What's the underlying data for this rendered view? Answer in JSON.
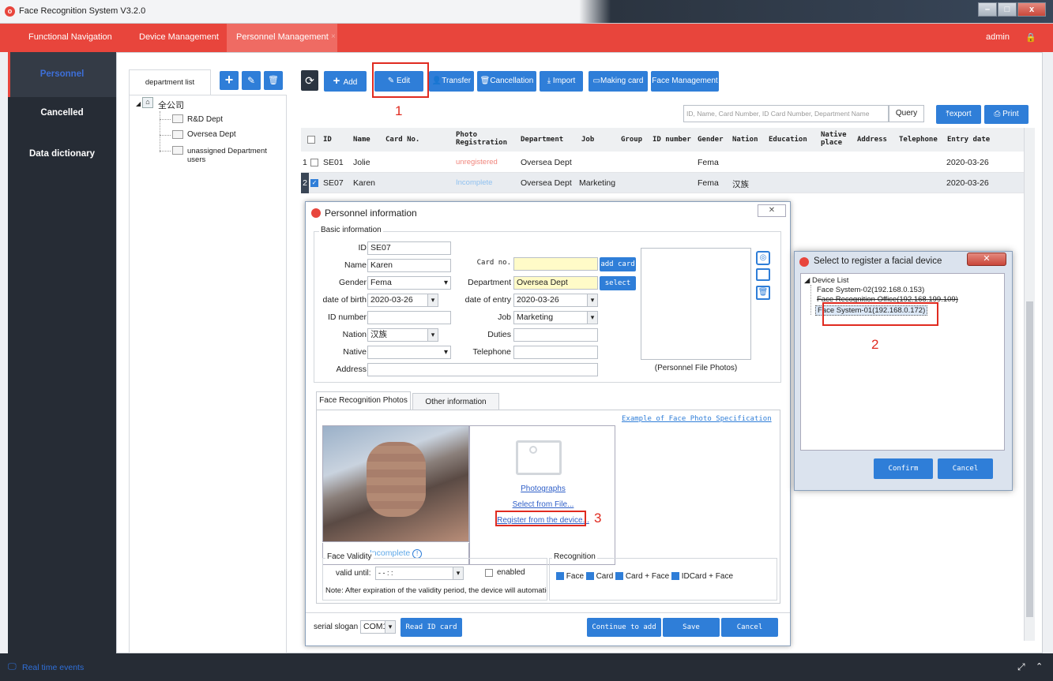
{
  "app": {
    "title": "Face Recognition System V3.2.0"
  },
  "topnav": {
    "items": [
      "Functional Navigation",
      "Device Management",
      "Personnel Management"
    ],
    "user": "admin"
  },
  "sidebar": {
    "items": [
      "Personnel",
      "Cancelled",
      "Data dictionary"
    ]
  },
  "dept": {
    "tab": "department list",
    "root": "全公司",
    "children": [
      "R&D Dept",
      "Oversea Dept",
      "unassigned Department users"
    ]
  },
  "toolbar": {
    "add": "Add",
    "edit": "Edit",
    "transfer": "Transfer",
    "cancellation": "Cancellation",
    "import": "Import",
    "making_card": "Making card",
    "face_mgmt": "Face Management"
  },
  "search": {
    "placeholder": "ID, Name, Card Number, ID Card Number, Department Name",
    "query": "Query",
    "export": "export",
    "print": "Print"
  },
  "table": {
    "columns": [
      "ID",
      "Name",
      "Card No.",
      "Photo Registration",
      "Department",
      "Job",
      "Group",
      "ID number",
      "Gender",
      "Nation",
      "Education",
      "Native place",
      "Address",
      "Telephone",
      "Entry date"
    ],
    "rows": [
      {
        "n": "1",
        "id": "SE01",
        "name": "Jolie",
        "photo": "unregistered",
        "dept": "Oversea Dept",
        "job": "",
        "gender": "Fema",
        "nation": "",
        "date": "2020-03-26"
      },
      {
        "n": "2",
        "id": "SE07",
        "name": "Karen",
        "photo": "Incomplete",
        "dept": "Oversea Dept",
        "job": "Marketing",
        "gender": "Fema",
        "nation": "汉族",
        "date": "2020-03-26"
      }
    ]
  },
  "markers": {
    "one": "1",
    "two": "2",
    "three": "3"
  },
  "dialog": {
    "title": "Personnel information",
    "basic": "Basic information",
    "labels": {
      "id": "ID",
      "name": "Name",
      "gender": "Gender",
      "dob": "date of birth",
      "idnum": "ID number",
      "nation": "Nation",
      "native": "Native",
      "address": "Address",
      "card": "Card no.",
      "dept": "Department",
      "entry": "date of entry",
      "job": "Job",
      "duties": "Duties",
      "tel": "Telephone"
    },
    "values": {
      "id": "SE07",
      "name": "Karen",
      "gender": "Fema",
      "dob": "2020-03-26",
      "nation": "汉族",
      "dept": "Oversea Dept",
      "entry": "2020-03-26",
      "job": "Marketing"
    },
    "add_card": "add card",
    "select": "select",
    "file_photos": "(Personnel File Photos)",
    "tabs": [
      "Face Recognition Photos",
      "Other information"
    ],
    "example_link": "Example of Face Photo Specification",
    "photo_status": "Incomplete",
    "photographs": "Photographs",
    "select_file": "Select from File...",
    "register_device": "Register from the device...",
    "validity": {
      "title": "Face Validity",
      "valid_until": "valid until:",
      "value": "- -   : :",
      "enabled": "enabled",
      "note": "Note: After expiration of the validity period, the device will automatic"
    },
    "recognition": {
      "title": "Recognition",
      "opts": [
        "Face",
        "Card",
        "Card + Face",
        "IDCard + Face"
      ]
    },
    "serial": "serial slogan",
    "com": "COM1",
    "read_id": "Read ID card",
    "continue": "Continue to add",
    "save": "Save",
    "cancel": "Cancel"
  },
  "devdlg": {
    "title": "Select to register a facial device",
    "root": "Device List",
    "items": [
      "Face System-02(192.168.0.153)",
      "Face Recognition Office(192.168.199.109)",
      "Face System-01(192.168.0.172)"
    ],
    "confirm": "Confirm",
    "cancel": "Cancel"
  },
  "bottom": {
    "events": "Real time events"
  }
}
